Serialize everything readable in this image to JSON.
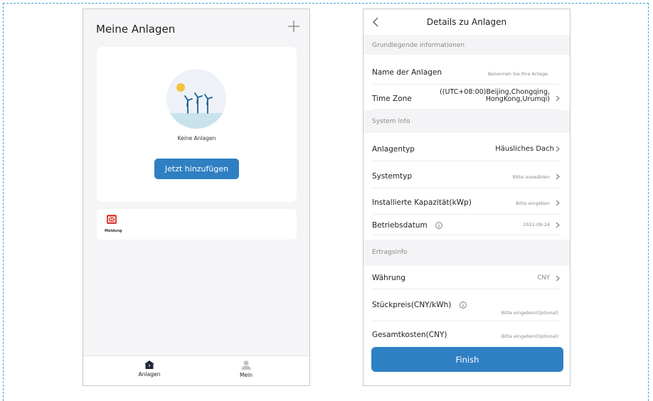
{
  "left_screen": {
    "title": "Meine Anlagen",
    "add_icon": "plus-icon",
    "empty_illustration": "wind-turbine-illustration",
    "empty_text": "Keine Anlagen",
    "add_button": "Jetzt hinzufügen",
    "message_icon": "envelope-icon",
    "message_label": "Meldung",
    "tabs": [
      {
        "label": "Anlagen",
        "icon": "home-icon",
        "active": true
      },
      {
        "label": "Mein",
        "icon": "user-icon",
        "active": false
      }
    ]
  },
  "right_screen": {
    "title": "Details zu Anlagen",
    "back_icon": "chevron-left-icon",
    "sections": {
      "basic": "Grundlegende informationen",
      "system": "System Info",
      "income": "Ertragsinfo"
    },
    "rows": {
      "name": {
        "label": "Name der Anlagen",
        "value": "Benennen Sie Ihre Anlage"
      },
      "timezone": {
        "label": "Time Zone",
        "value_line1": "((UTC+08:00)Beijing,Chongqing,",
        "value_line2": "HongKong,Urumqi)"
      },
      "plant_type": {
        "label": "Anlagentyp",
        "value": "Häusliches Dach"
      },
      "system_type": {
        "label": "Systemtyp",
        "value": "Bitte auswählen"
      },
      "capacity": {
        "label": "Installierte Kapazität(kWp)",
        "value": "Bitte eingeben"
      },
      "date": {
        "label": "Betriebsdatum",
        "value": "2022-09-24"
      },
      "currency": {
        "label": "Währung",
        "value": "CNY"
      },
      "unit_price": {
        "label": "Stückpreis(CNY/kWh)",
        "value": "Bitte eingeben(Optional)"
      },
      "total_cost": {
        "label": "Gesamtkosten(CNY)",
        "value": "Bitte eingeben(Optional)"
      }
    },
    "finish_button": "Finish"
  },
  "colors": {
    "accent": "#2f7fc3",
    "frame_dash": "#4a9fd4",
    "message_icon": "#d9443b",
    "section_bg": "#f4f4f6"
  }
}
